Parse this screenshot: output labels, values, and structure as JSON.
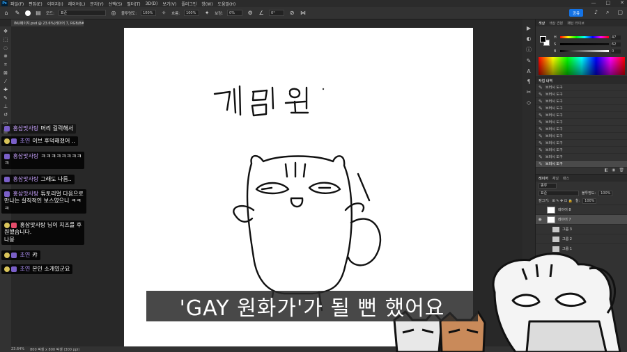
{
  "menubar": {
    "app_icon": "Ps",
    "items": [
      "파일(F)",
      "편집(E)",
      "이미지(I)",
      "레이어(L)",
      "문자(Y)",
      "선택(S)",
      "필터(T)",
      "3D(D)",
      "보기(V)",
      "플러그인",
      "창(W)",
      "도움말(H)"
    ],
    "window_controls": [
      "—",
      "□",
      "✕"
    ]
  },
  "options": {
    "mode_label": "모드:",
    "mode_value": "표준",
    "opacity_label": "불투명도:",
    "opacity_value": "100%",
    "flow_label": "흐름:",
    "flow_value": "100%",
    "smoothing_label": "보정:",
    "smoothing_value": "0%",
    "angle_value": "0°",
    "share_label": "공유"
  },
  "document": {
    "tab_title": "INU페이지.psd @ 23.6%(레이어 7, RGB/8#) *"
  },
  "status": {
    "zoom": "23.64%",
    "doc_size": "800 픽셀 x 800 픽셀 (300 ppi)"
  },
  "panels": {
    "color_tabs": [
      "색상",
      "색상 견본",
      "패턴 라이브"
    ],
    "sliders": [
      {
        "label": "H",
        "value": "47"
      },
      {
        "label": "S",
        "value": "62"
      },
      {
        "label": "B",
        "value": "0"
      }
    ],
    "history_tab": "작업 내역",
    "history_items": [
      "브러시 도구",
      "브러시 도구",
      "브러시 도구",
      "브러시 도구",
      "브러시 도구",
      "브러시 도구",
      "브러시 도구",
      "브러시 도구",
      "브러시 도구",
      "브러시 도구",
      "브러시 도구",
      "브러시 도구"
    ],
    "layers_tabs": [
      "레이어",
      "채널",
      "패스"
    ],
    "kind_label": "종류",
    "blend_mode": "표준",
    "opacity_label": "불투명도:",
    "opacity_value": "100%",
    "lock_label": "잠그기:",
    "fill_label": "칠:",
    "fill_value": "100%",
    "layers": [
      {
        "name": "레이어 8",
        "type": "layer",
        "selected": false
      },
      {
        "name": "레이어 7",
        "type": "layer",
        "selected": true
      },
      {
        "name": "그룹 3",
        "type": "group",
        "selected": false
      },
      {
        "name": "그룹 2",
        "type": "group",
        "selected": false
      },
      {
        "name": "그룹 1",
        "type": "group",
        "selected": false
      }
    ]
  },
  "canvas": {
    "handwritten_text": "게임 원"
  },
  "chat": [
    {
      "nick": "홍삼맛사탕",
      "text": "머리 길럭해서"
    },
    {
      "nick": "초연",
      "text": "이브 후덕해졌어 .."
    },
    {
      "nick": "홍삼맛사탕",
      "text": "ㅋㅋㅋㅋㅋㅋㅋㅋ",
      "text2": "ㅋ"
    },
    {
      "nick": "홍삼맛사탕",
      "text": "그래도 나름.."
    },
    {
      "nick": "홍삼맛사탕",
      "text": "튜토리얼 다음으로",
      "text2": "만나는 실직적인 보스였으니 ㅋㅋ",
      "text3": "ㅋ"
    },
    {
      "nick": "",
      "text": "홍삼맛사탕 님이 치즈를 후",
      "text2": "원했습니다.",
      "text3": "나몽"
    },
    {
      "nick": "초연",
      "text": "캬"
    },
    {
      "nick": "초연",
      "text": "본인 소개였군요"
    }
  ],
  "subtitle": "'GAY 원화가'가 될 뻔 했어요"
}
